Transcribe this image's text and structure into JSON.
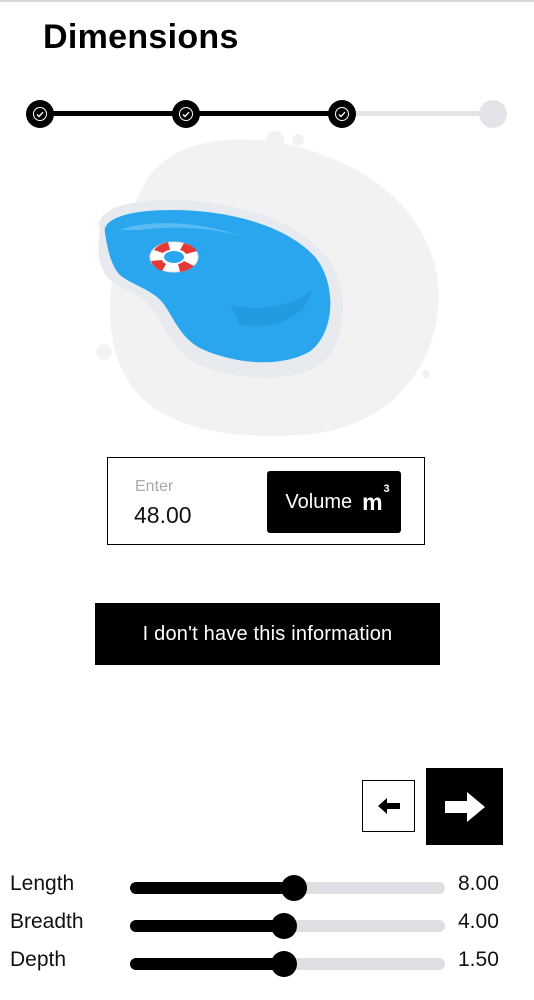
{
  "header": {
    "title": "Dimensions"
  },
  "stepper": {
    "total_steps": 4,
    "completed_steps": 3
  },
  "volume": {
    "placeholder": "Enter",
    "value": "48.00",
    "unit_label": "Volume",
    "unit_symbol": "m",
    "unit_exponent": "3"
  },
  "no_info_button": {
    "label": "I don't have this information"
  },
  "navigation": {
    "back_icon": "arrow-left-icon",
    "next_icon": "arrow-right-icon"
  },
  "sliders": [
    {
      "label": "Length",
      "value": "8.00",
      "fraction": 0.52
    },
    {
      "label": "Breadth",
      "value": "4.00",
      "fraction": 0.49
    },
    {
      "label": "Depth",
      "value": "1.50",
      "fraction": 0.49
    }
  ],
  "colors": {
    "primary": "#000000",
    "inactive": "#e3e4e8",
    "pool_water": "#2aa6ee",
    "blob": "#f2f2f3"
  }
}
